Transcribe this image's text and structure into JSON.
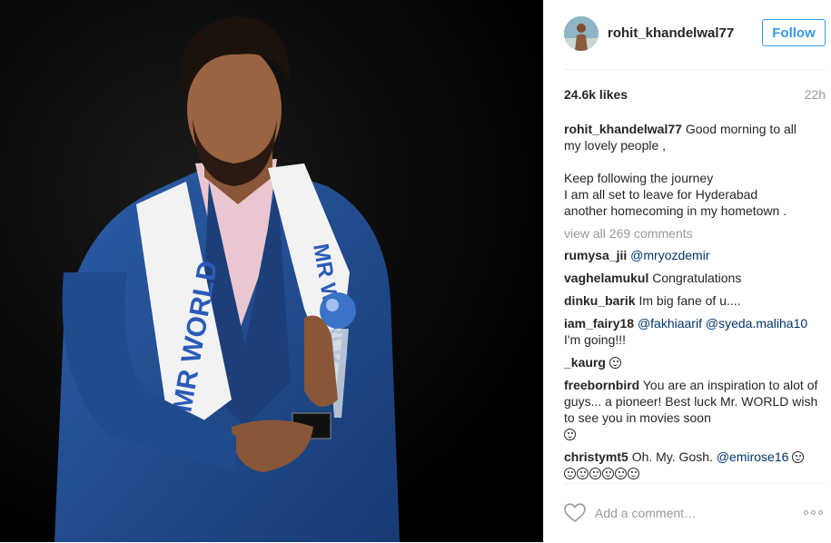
{
  "photo": {
    "sash_text_left": "MR WORLD",
    "sash_text_right": "MR WORLD"
  },
  "header": {
    "username": "rohit_khandelwal77",
    "follow_label": "Follow"
  },
  "stats": {
    "likes": "24.6k likes",
    "time": "22h"
  },
  "caption": {
    "user": "rohit_khandelwal77",
    "lines": [
      "Good morning to all",
      "my lovely people ,",
      "",
      "Keep following the journey",
      "I am all set to leave for Hyderabad",
      "another homecoming in my hometown ."
    ]
  },
  "view_all_label": "view all 269 comments",
  "comments": [
    {
      "user": "rumysa_jii",
      "text": "",
      "mentions": "@mryozdemir"
    },
    {
      "user": "vaghelamukul",
      "text": "Congratulations"
    },
    {
      "user": "dinku_barik",
      "text": "Im big fane of u...."
    },
    {
      "user": "iam_fairy18",
      "mentions": "@fakhiaarif @syeda.maliha10",
      "text2": "I'm going!!!"
    },
    {
      "user": "_kaurg",
      "emoji_count": 1
    },
    {
      "user": "freebornbird",
      "text": "You are an inspiration to alot of guys... a pioneer! Best luck Mr. WORLD wish to see you in movies soon",
      "emoji_count": 1
    },
    {
      "user": "christymt5",
      "text": "Oh. My. Gosh.",
      "mentions": "@emirose16",
      "emoji_count": 1,
      "emoji_line_count": 6
    }
  ],
  "footer": {
    "add_comment_placeholder": "Add a comment…"
  },
  "colors": {
    "accent": "#3897f0",
    "mention": "#003569",
    "muted": "#999999",
    "suit": "#1f4a8c"
  }
}
